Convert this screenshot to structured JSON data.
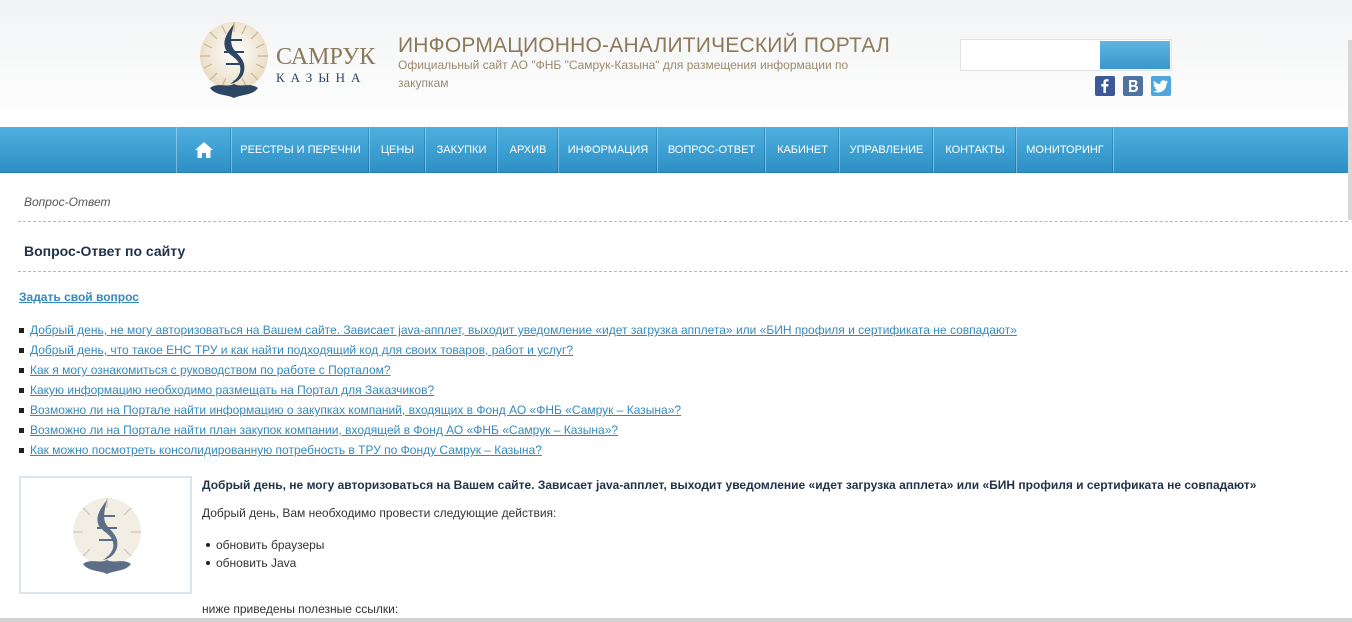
{
  "header": {
    "logo": {
      "main": "САМРУК",
      "sub": "КАЗЫНА"
    },
    "title": "ИНФОРМАЦИОННО-АНАЛИТИЧЕСКИЙ ПОРТАЛ",
    "subtitle": "Официальный сайт АО \"ФНБ \"Самрук-Казына\" для размещения информации по закупкам",
    "search": {
      "value": "",
      "placeholder": ""
    },
    "social": [
      "facebook-icon",
      "vk-icon",
      "twitter-icon"
    ]
  },
  "nav": {
    "home_icon": "home-icon",
    "items": [
      {
        "label": "РЕЕСТРЫ И ПЕРЕЧНИ"
      },
      {
        "label": "ЦЕНЫ"
      },
      {
        "label": "ЗАКУПКИ"
      },
      {
        "label": "АРХИВ"
      },
      {
        "label": "ИНФОРМАЦИЯ"
      },
      {
        "label": "ВОПРОС-ОТВЕТ"
      },
      {
        "label": "КАБИНЕТ"
      },
      {
        "label": "УПРАВЛЕНИЕ"
      },
      {
        "label": "КОНТАКТЫ"
      },
      {
        "label": "МОНИТОРИНГ"
      }
    ]
  },
  "content": {
    "breadcrumb": "Вопрос-Ответ",
    "page_title": "Вопрос-Ответ по сайту",
    "ask_link": "Задать свой вопрос",
    "questions": [
      "Добрый день, не могу авторизоваться на Вашем сайте. Зависает java-апплет, выходит уведомление «идет загрузка апплета» или «БИН профиля и сертификата не совпадают»",
      "Добрый день, что такое ЕНС ТРУ и как найти подходящий код для своих товаров, работ и услуг?",
      "Как я могу ознакомиться с руководством по работе с Порталом?",
      "Какую информацию необходимо размещать на Портал для Заказчиков?",
      "Возможно ли на Портале найти информацию о закупках компаний, входящих в Фонд АО «ФНБ «Самрук – Казына»?",
      "Возможно ли на Портале найти план закупок компании, входящей в Фонд АО «ФНБ «Самрук – Казына»?",
      "Как можно посмотреть консолидированную потребность в ТРУ по Фонду Самрук – Казына?"
    ],
    "answer": {
      "question": "Добрый день, не могу авторизоваться на Вашем сайте. Зависает java-апплет, выходит уведомление «идет загрузка апплета» или «БИН профиля и сертификата не совпадают»",
      "intro": "Добрый день, Вам необходимо провести следующие действия:",
      "steps": [
        "обновить браузеры",
        "обновить Java"
      ],
      "links_intro": "ниже приведены полезные ссылки:"
    }
  },
  "colors": {
    "nav_top": "#4fb0e0",
    "nav_bottom": "#2d8fc4",
    "link": "#3489bd",
    "title_gold": "#8c7a5a",
    "logo_blue": "#2d4663"
  }
}
